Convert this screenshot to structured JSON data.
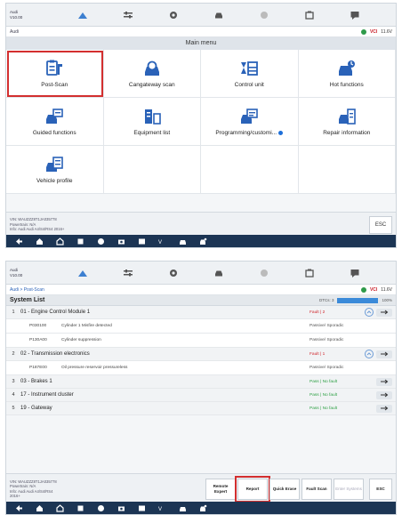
{
  "colors": {
    "accent": "#2a62b8",
    "highlight": "#d32f2f",
    "fault": "#d0262c",
    "pass": "#2fa046",
    "navbar": "#1c3554"
  },
  "screen1": {
    "car_id": [
      "Audi",
      "V10.00"
    ],
    "breadcrumb": "Audi",
    "title": "Main menu",
    "status": {
      "vci": "VCI",
      "battery": "11.6V"
    },
    "tiles": [
      {
        "label": "Post-Scan",
        "icon": "post-scan-icon"
      },
      {
        "label": "Cangateway scan",
        "icon": "gateway-scan-icon"
      },
      {
        "label": "Control unit",
        "icon": "control-unit-icon"
      },
      {
        "label": "Hot functions",
        "icon": "hot-functions-icon"
      },
      {
        "label": "Guided functions",
        "icon": "guided-functions-icon"
      },
      {
        "label": "Equipment list",
        "icon": "equipment-list-icon"
      },
      {
        "label": "Programming/customi...",
        "icon": "programming-icon"
      },
      {
        "label": "Repair information",
        "icon": "repair-info-icon"
      },
      {
        "label": "Vehicle profile",
        "icon": "vehicle-profile-icon"
      }
    ],
    "vin_lines": [
      "VIN: WAUZZZ8T1JA035778",
      "Powertrain: N/A",
      "Info: Audi Audi A4/S4/RS4 2016+"
    ],
    "esc": "ESC"
  },
  "screen2": {
    "car_id": [
      "Audi",
      "V10.00"
    ],
    "breadcrumb": "Audi > Post-Scan",
    "status": {
      "vci": "VCI",
      "battery": "11.6V"
    },
    "title": "System List",
    "dtc_label": "DTCs: 3",
    "progress_label": "100%",
    "progress_fraction": 1.0,
    "modules": [
      {
        "num": "1",
        "name": "01 - Engine Control Module 1",
        "status": "Fault | 2",
        "type": "fault",
        "expanded": true,
        "dtcs": [
          {
            "code": "P030100",
            "desc": "Cylinder 1 Misfire detected",
            "status": "Passive/ Sporadic"
          },
          {
            "code": "P130A00",
            "desc": "Cylinder suppression",
            "status": "Passive/ Sporadic"
          }
        ]
      },
      {
        "num": "2",
        "name": "02 - Transmission electronics",
        "status": "Fault | 1",
        "type": "fault",
        "expanded": true,
        "dtcs": [
          {
            "code": "P187E00",
            "desc": "Oil pressure reservoir pressureless",
            "status": "Passive/ Sporadic"
          }
        ]
      },
      {
        "num": "3",
        "name": "03 - Brakes 1",
        "status": "Pass | No fault",
        "type": "pass",
        "expanded": false,
        "dtcs": []
      },
      {
        "num": "4",
        "name": "17 - Instrument cluster",
        "status": "Pass | No fault",
        "type": "pass",
        "expanded": false,
        "dtcs": []
      },
      {
        "num": "5",
        "name": "19 - Gateway",
        "status": "Pass | No fault",
        "type": "pass",
        "expanded": false,
        "dtcs": []
      }
    ],
    "vin_lines": [
      "VIN: WAUZZZ8T1JA035778",
      "Powertrain: N/A",
      "Info: Audi Audi A4/S4/RS4",
      "2016+"
    ],
    "buttons": {
      "remote": "Remote Expert",
      "report": "Report",
      "quick": "Quick Erase",
      "fault": "Fault Scan",
      "enter": "Enter Systems",
      "esc": "ESC"
    }
  }
}
